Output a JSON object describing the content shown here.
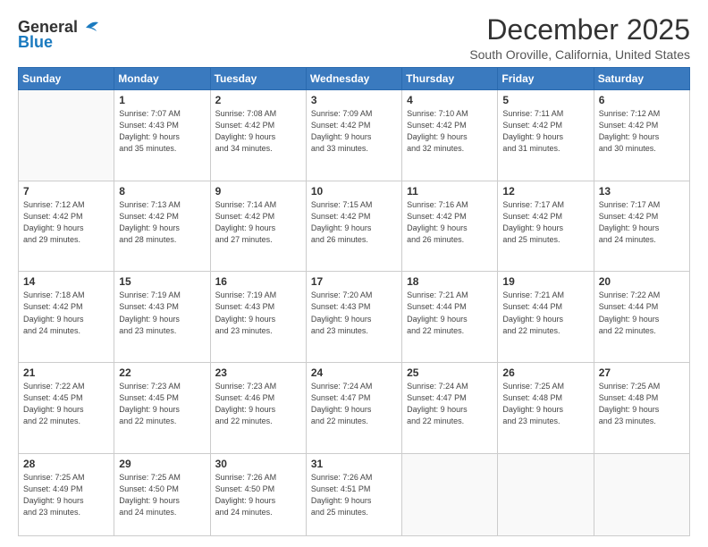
{
  "header": {
    "logo_general": "General",
    "logo_blue": "Blue",
    "main_title": "December 2025",
    "subtitle": "South Oroville, California, United States"
  },
  "days_of_week": [
    "Sunday",
    "Monday",
    "Tuesday",
    "Wednesday",
    "Thursday",
    "Friday",
    "Saturday"
  ],
  "weeks": [
    [
      {
        "day": "",
        "info": ""
      },
      {
        "day": "1",
        "info": "Sunrise: 7:07 AM\nSunset: 4:43 PM\nDaylight: 9 hours\nand 35 minutes."
      },
      {
        "day": "2",
        "info": "Sunrise: 7:08 AM\nSunset: 4:42 PM\nDaylight: 9 hours\nand 34 minutes."
      },
      {
        "day": "3",
        "info": "Sunrise: 7:09 AM\nSunset: 4:42 PM\nDaylight: 9 hours\nand 33 minutes."
      },
      {
        "day": "4",
        "info": "Sunrise: 7:10 AM\nSunset: 4:42 PM\nDaylight: 9 hours\nand 32 minutes."
      },
      {
        "day": "5",
        "info": "Sunrise: 7:11 AM\nSunset: 4:42 PM\nDaylight: 9 hours\nand 31 minutes."
      },
      {
        "day": "6",
        "info": "Sunrise: 7:12 AM\nSunset: 4:42 PM\nDaylight: 9 hours\nand 30 minutes."
      }
    ],
    [
      {
        "day": "7",
        "info": "Sunrise: 7:12 AM\nSunset: 4:42 PM\nDaylight: 9 hours\nand 29 minutes."
      },
      {
        "day": "8",
        "info": "Sunrise: 7:13 AM\nSunset: 4:42 PM\nDaylight: 9 hours\nand 28 minutes."
      },
      {
        "day": "9",
        "info": "Sunrise: 7:14 AM\nSunset: 4:42 PM\nDaylight: 9 hours\nand 27 minutes."
      },
      {
        "day": "10",
        "info": "Sunrise: 7:15 AM\nSunset: 4:42 PM\nDaylight: 9 hours\nand 26 minutes."
      },
      {
        "day": "11",
        "info": "Sunrise: 7:16 AM\nSunset: 4:42 PM\nDaylight: 9 hours\nand 26 minutes."
      },
      {
        "day": "12",
        "info": "Sunrise: 7:17 AM\nSunset: 4:42 PM\nDaylight: 9 hours\nand 25 minutes."
      },
      {
        "day": "13",
        "info": "Sunrise: 7:17 AM\nSunset: 4:42 PM\nDaylight: 9 hours\nand 24 minutes."
      }
    ],
    [
      {
        "day": "14",
        "info": "Sunrise: 7:18 AM\nSunset: 4:42 PM\nDaylight: 9 hours\nand 24 minutes."
      },
      {
        "day": "15",
        "info": "Sunrise: 7:19 AM\nSunset: 4:43 PM\nDaylight: 9 hours\nand 23 minutes."
      },
      {
        "day": "16",
        "info": "Sunrise: 7:19 AM\nSunset: 4:43 PM\nDaylight: 9 hours\nand 23 minutes."
      },
      {
        "day": "17",
        "info": "Sunrise: 7:20 AM\nSunset: 4:43 PM\nDaylight: 9 hours\nand 23 minutes."
      },
      {
        "day": "18",
        "info": "Sunrise: 7:21 AM\nSunset: 4:44 PM\nDaylight: 9 hours\nand 22 minutes."
      },
      {
        "day": "19",
        "info": "Sunrise: 7:21 AM\nSunset: 4:44 PM\nDaylight: 9 hours\nand 22 minutes."
      },
      {
        "day": "20",
        "info": "Sunrise: 7:22 AM\nSunset: 4:44 PM\nDaylight: 9 hours\nand 22 minutes."
      }
    ],
    [
      {
        "day": "21",
        "info": "Sunrise: 7:22 AM\nSunset: 4:45 PM\nDaylight: 9 hours\nand 22 minutes."
      },
      {
        "day": "22",
        "info": "Sunrise: 7:23 AM\nSunset: 4:45 PM\nDaylight: 9 hours\nand 22 minutes."
      },
      {
        "day": "23",
        "info": "Sunrise: 7:23 AM\nSunset: 4:46 PM\nDaylight: 9 hours\nand 22 minutes."
      },
      {
        "day": "24",
        "info": "Sunrise: 7:24 AM\nSunset: 4:47 PM\nDaylight: 9 hours\nand 22 minutes."
      },
      {
        "day": "25",
        "info": "Sunrise: 7:24 AM\nSunset: 4:47 PM\nDaylight: 9 hours\nand 22 minutes."
      },
      {
        "day": "26",
        "info": "Sunrise: 7:25 AM\nSunset: 4:48 PM\nDaylight: 9 hours\nand 23 minutes."
      },
      {
        "day": "27",
        "info": "Sunrise: 7:25 AM\nSunset: 4:48 PM\nDaylight: 9 hours\nand 23 minutes."
      }
    ],
    [
      {
        "day": "28",
        "info": "Sunrise: 7:25 AM\nSunset: 4:49 PM\nDaylight: 9 hours\nand 23 minutes."
      },
      {
        "day": "29",
        "info": "Sunrise: 7:25 AM\nSunset: 4:50 PM\nDaylight: 9 hours\nand 24 minutes."
      },
      {
        "day": "30",
        "info": "Sunrise: 7:26 AM\nSunset: 4:50 PM\nDaylight: 9 hours\nand 24 minutes."
      },
      {
        "day": "31",
        "info": "Sunrise: 7:26 AM\nSunset: 4:51 PM\nDaylight: 9 hours\nand 25 minutes."
      },
      {
        "day": "",
        "info": ""
      },
      {
        "day": "",
        "info": ""
      },
      {
        "day": "",
        "info": ""
      }
    ]
  ]
}
